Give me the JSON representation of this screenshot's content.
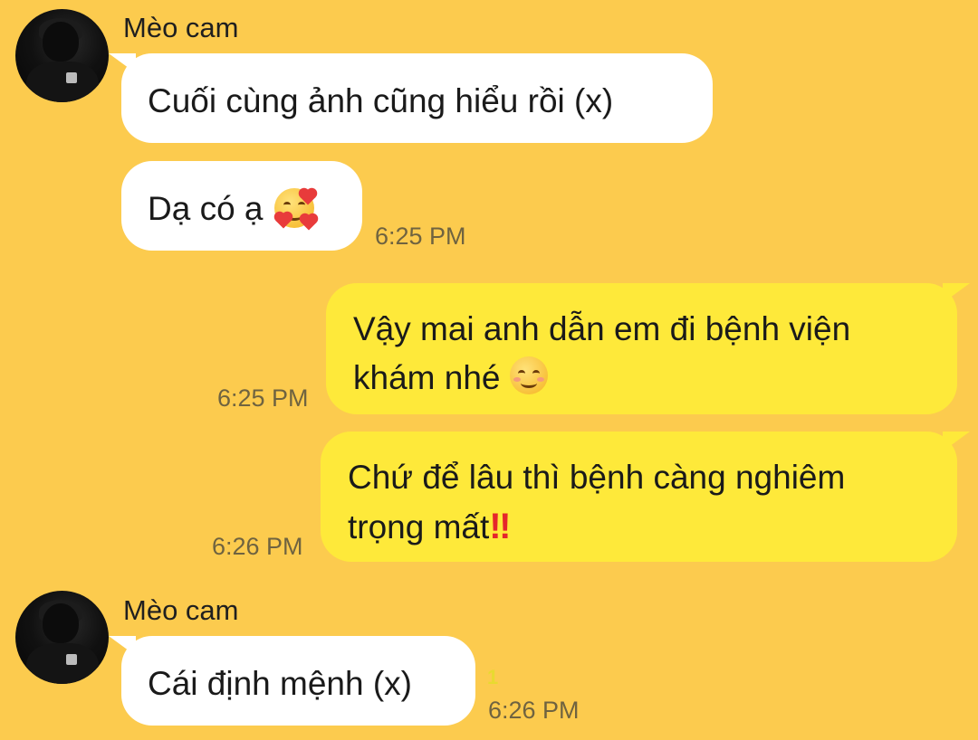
{
  "messages": [
    {
      "sender": "Mèo cam",
      "text": "Cuối cùng ảnh cũng hiểu rồi (x)"
    },
    {
      "text": "Dạ có ạ",
      "emoji": "smiling-face-with-hearts-icon",
      "time": "6:25 PM"
    },
    {
      "text": "Vậy mai anh dẫn em đi bệnh viện khám nhé",
      "emoji": "smiling-face-icon",
      "time": "6:25 PM"
    },
    {
      "text": "Chứ để lâu thì bệnh càng nghiêm trọng mất",
      "emoji": "double-exclamation-icon",
      "emoji_char": "‼",
      "time": "6:26 PM"
    },
    {
      "sender": "Mèo cam",
      "text": "Cái định mệnh (x)",
      "unread": "1",
      "time": "6:26 PM"
    }
  ],
  "colors": {
    "background": "#FCCB4E",
    "incoming_bubble": "#FFFFFF",
    "outgoing_bubble": "#FEE93A"
  }
}
